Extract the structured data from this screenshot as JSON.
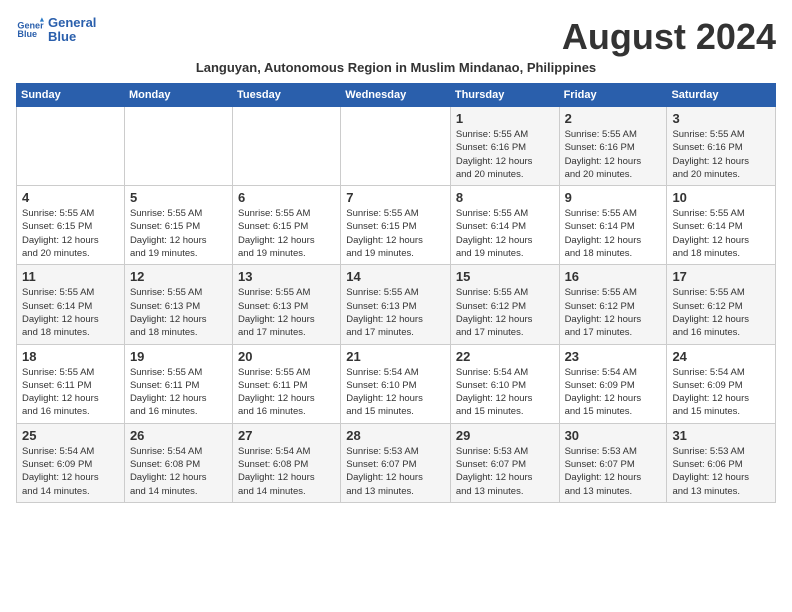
{
  "logo": {
    "name_line1": "General",
    "name_line2": "Blue"
  },
  "title": "August 2024",
  "subtitle": "Languyan, Autonomous Region in Muslim Mindanao, Philippines",
  "headers": [
    "Sunday",
    "Monday",
    "Tuesday",
    "Wednesday",
    "Thursday",
    "Friday",
    "Saturday"
  ],
  "weeks": [
    [
      {
        "day": "",
        "info": ""
      },
      {
        "day": "",
        "info": ""
      },
      {
        "day": "",
        "info": ""
      },
      {
        "day": "",
        "info": ""
      },
      {
        "day": "1",
        "info": "Sunrise: 5:55 AM\nSunset: 6:16 PM\nDaylight: 12 hours\nand 20 minutes."
      },
      {
        "day": "2",
        "info": "Sunrise: 5:55 AM\nSunset: 6:16 PM\nDaylight: 12 hours\nand 20 minutes."
      },
      {
        "day": "3",
        "info": "Sunrise: 5:55 AM\nSunset: 6:16 PM\nDaylight: 12 hours\nand 20 minutes."
      }
    ],
    [
      {
        "day": "4",
        "info": "Sunrise: 5:55 AM\nSunset: 6:15 PM\nDaylight: 12 hours\nand 20 minutes."
      },
      {
        "day": "5",
        "info": "Sunrise: 5:55 AM\nSunset: 6:15 PM\nDaylight: 12 hours\nand 19 minutes."
      },
      {
        "day": "6",
        "info": "Sunrise: 5:55 AM\nSunset: 6:15 PM\nDaylight: 12 hours\nand 19 minutes."
      },
      {
        "day": "7",
        "info": "Sunrise: 5:55 AM\nSunset: 6:15 PM\nDaylight: 12 hours\nand 19 minutes."
      },
      {
        "day": "8",
        "info": "Sunrise: 5:55 AM\nSunset: 6:14 PM\nDaylight: 12 hours\nand 19 minutes."
      },
      {
        "day": "9",
        "info": "Sunrise: 5:55 AM\nSunset: 6:14 PM\nDaylight: 12 hours\nand 18 minutes."
      },
      {
        "day": "10",
        "info": "Sunrise: 5:55 AM\nSunset: 6:14 PM\nDaylight: 12 hours\nand 18 minutes."
      }
    ],
    [
      {
        "day": "11",
        "info": "Sunrise: 5:55 AM\nSunset: 6:14 PM\nDaylight: 12 hours\nand 18 minutes."
      },
      {
        "day": "12",
        "info": "Sunrise: 5:55 AM\nSunset: 6:13 PM\nDaylight: 12 hours\nand 18 minutes."
      },
      {
        "day": "13",
        "info": "Sunrise: 5:55 AM\nSunset: 6:13 PM\nDaylight: 12 hours\nand 17 minutes."
      },
      {
        "day": "14",
        "info": "Sunrise: 5:55 AM\nSunset: 6:13 PM\nDaylight: 12 hours\nand 17 minutes."
      },
      {
        "day": "15",
        "info": "Sunrise: 5:55 AM\nSunset: 6:12 PM\nDaylight: 12 hours\nand 17 minutes."
      },
      {
        "day": "16",
        "info": "Sunrise: 5:55 AM\nSunset: 6:12 PM\nDaylight: 12 hours\nand 17 minutes."
      },
      {
        "day": "17",
        "info": "Sunrise: 5:55 AM\nSunset: 6:12 PM\nDaylight: 12 hours\nand 16 minutes."
      }
    ],
    [
      {
        "day": "18",
        "info": "Sunrise: 5:55 AM\nSunset: 6:11 PM\nDaylight: 12 hours\nand 16 minutes."
      },
      {
        "day": "19",
        "info": "Sunrise: 5:55 AM\nSunset: 6:11 PM\nDaylight: 12 hours\nand 16 minutes."
      },
      {
        "day": "20",
        "info": "Sunrise: 5:55 AM\nSunset: 6:11 PM\nDaylight: 12 hours\nand 16 minutes."
      },
      {
        "day": "21",
        "info": "Sunrise: 5:54 AM\nSunset: 6:10 PM\nDaylight: 12 hours\nand 15 minutes."
      },
      {
        "day": "22",
        "info": "Sunrise: 5:54 AM\nSunset: 6:10 PM\nDaylight: 12 hours\nand 15 minutes."
      },
      {
        "day": "23",
        "info": "Sunrise: 5:54 AM\nSunset: 6:09 PM\nDaylight: 12 hours\nand 15 minutes."
      },
      {
        "day": "24",
        "info": "Sunrise: 5:54 AM\nSunset: 6:09 PM\nDaylight: 12 hours\nand 15 minutes."
      }
    ],
    [
      {
        "day": "25",
        "info": "Sunrise: 5:54 AM\nSunset: 6:09 PM\nDaylight: 12 hours\nand 14 minutes."
      },
      {
        "day": "26",
        "info": "Sunrise: 5:54 AM\nSunset: 6:08 PM\nDaylight: 12 hours\nand 14 minutes."
      },
      {
        "day": "27",
        "info": "Sunrise: 5:54 AM\nSunset: 6:08 PM\nDaylight: 12 hours\nand 14 minutes."
      },
      {
        "day": "28",
        "info": "Sunrise: 5:53 AM\nSunset: 6:07 PM\nDaylight: 12 hours\nand 13 minutes."
      },
      {
        "day": "29",
        "info": "Sunrise: 5:53 AM\nSunset: 6:07 PM\nDaylight: 12 hours\nand 13 minutes."
      },
      {
        "day": "30",
        "info": "Sunrise: 5:53 AM\nSunset: 6:07 PM\nDaylight: 12 hours\nand 13 minutes."
      },
      {
        "day": "31",
        "info": "Sunrise: 5:53 AM\nSunset: 6:06 PM\nDaylight: 12 hours\nand 13 minutes."
      }
    ]
  ]
}
